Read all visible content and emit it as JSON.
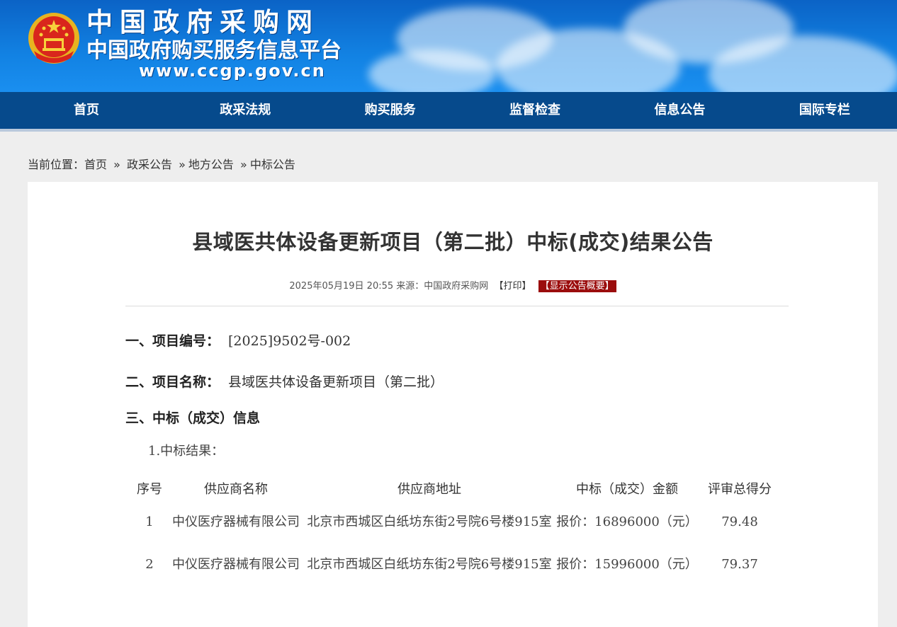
{
  "header": {
    "site_title": "中国政府采购网",
    "site_subtitle": "中国政府购买服务信息平台",
    "site_url": "www.ccgp.gov.cn"
  },
  "nav": {
    "items": [
      "首页",
      "政采法规",
      "购买服务",
      "监督检查",
      "信息公告",
      "国际专栏"
    ]
  },
  "breadcrumb": {
    "prefix": "当前位置：",
    "items": [
      "首页",
      "政采公告",
      "地方公告",
      "中标公告"
    ],
    "separator": "»"
  },
  "article": {
    "title": "县域医共体设备更新项目（第二批）中标(成交)结果公告",
    "datetime": "2025年05月19日 20:55",
    "source_label": "来源：",
    "source": "中国政府采购网",
    "print_label": "【打印】",
    "summary_label": "【显示公告概要】"
  },
  "sections": {
    "s1_label": "一、项目编号：",
    "s1_value": "[2025]9502号-002",
    "s2_label": "二、项目名称：",
    "s2_value": "县域医共体设备更新项目（第二批）",
    "s3_label": "三、中标（成交）信息",
    "sub1": "1.中标结果："
  },
  "table": {
    "headers": [
      "序号",
      "供应商名称",
      "供应商地址",
      "中标（成交）金额",
      "评审总得分"
    ],
    "rows": [
      [
        "1",
        "中仪医疗器械有限公司",
        "北京市西城区白纸坊东街2号院6号楼915室",
        "报价：16896000（元）",
        "79.48"
      ],
      [
        "2",
        "中仪医疗器械有限公司",
        "北京市西城区白纸坊东街2号院6号楼915室",
        "报价：15996000（元）",
        "79.37"
      ]
    ]
  },
  "colors": {
    "nav_bg": "#064a8c",
    "header_blue": "#1282e3",
    "summary_badge": "#9b0d0d"
  }
}
